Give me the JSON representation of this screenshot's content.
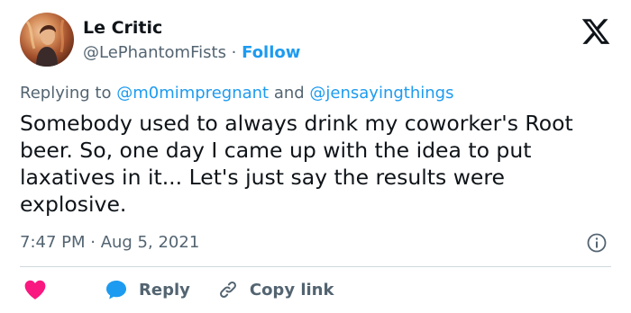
{
  "author": {
    "display_name": "Le Critic",
    "handle": "@LePhantomFists",
    "separator": " · ",
    "follow_label": "Follow"
  },
  "replying": {
    "prefix": "Replying to ",
    "mention1": "@m0mimpregnant",
    "conjunction": " and ",
    "mention2": "@jensayingthings"
  },
  "tweet": {
    "text": "Somebody used to always drink my coworker's Root beer. So, one day I came up with the idea to put laxatives in it... Let's just say the results were explosive."
  },
  "meta": {
    "timestamp": "7:47 PM · Aug 5, 2021"
  },
  "actions": {
    "reply_label": "Reply",
    "copy_link_label": "Copy link"
  },
  "colors": {
    "accent": "#1d9bf0",
    "heart": "#f91880",
    "secondary_text": "#536471",
    "divider": "#cfd9de"
  },
  "icons": [
    "x-logo-icon",
    "info-icon",
    "heart-icon",
    "reply-bubble-icon",
    "link-icon"
  ]
}
